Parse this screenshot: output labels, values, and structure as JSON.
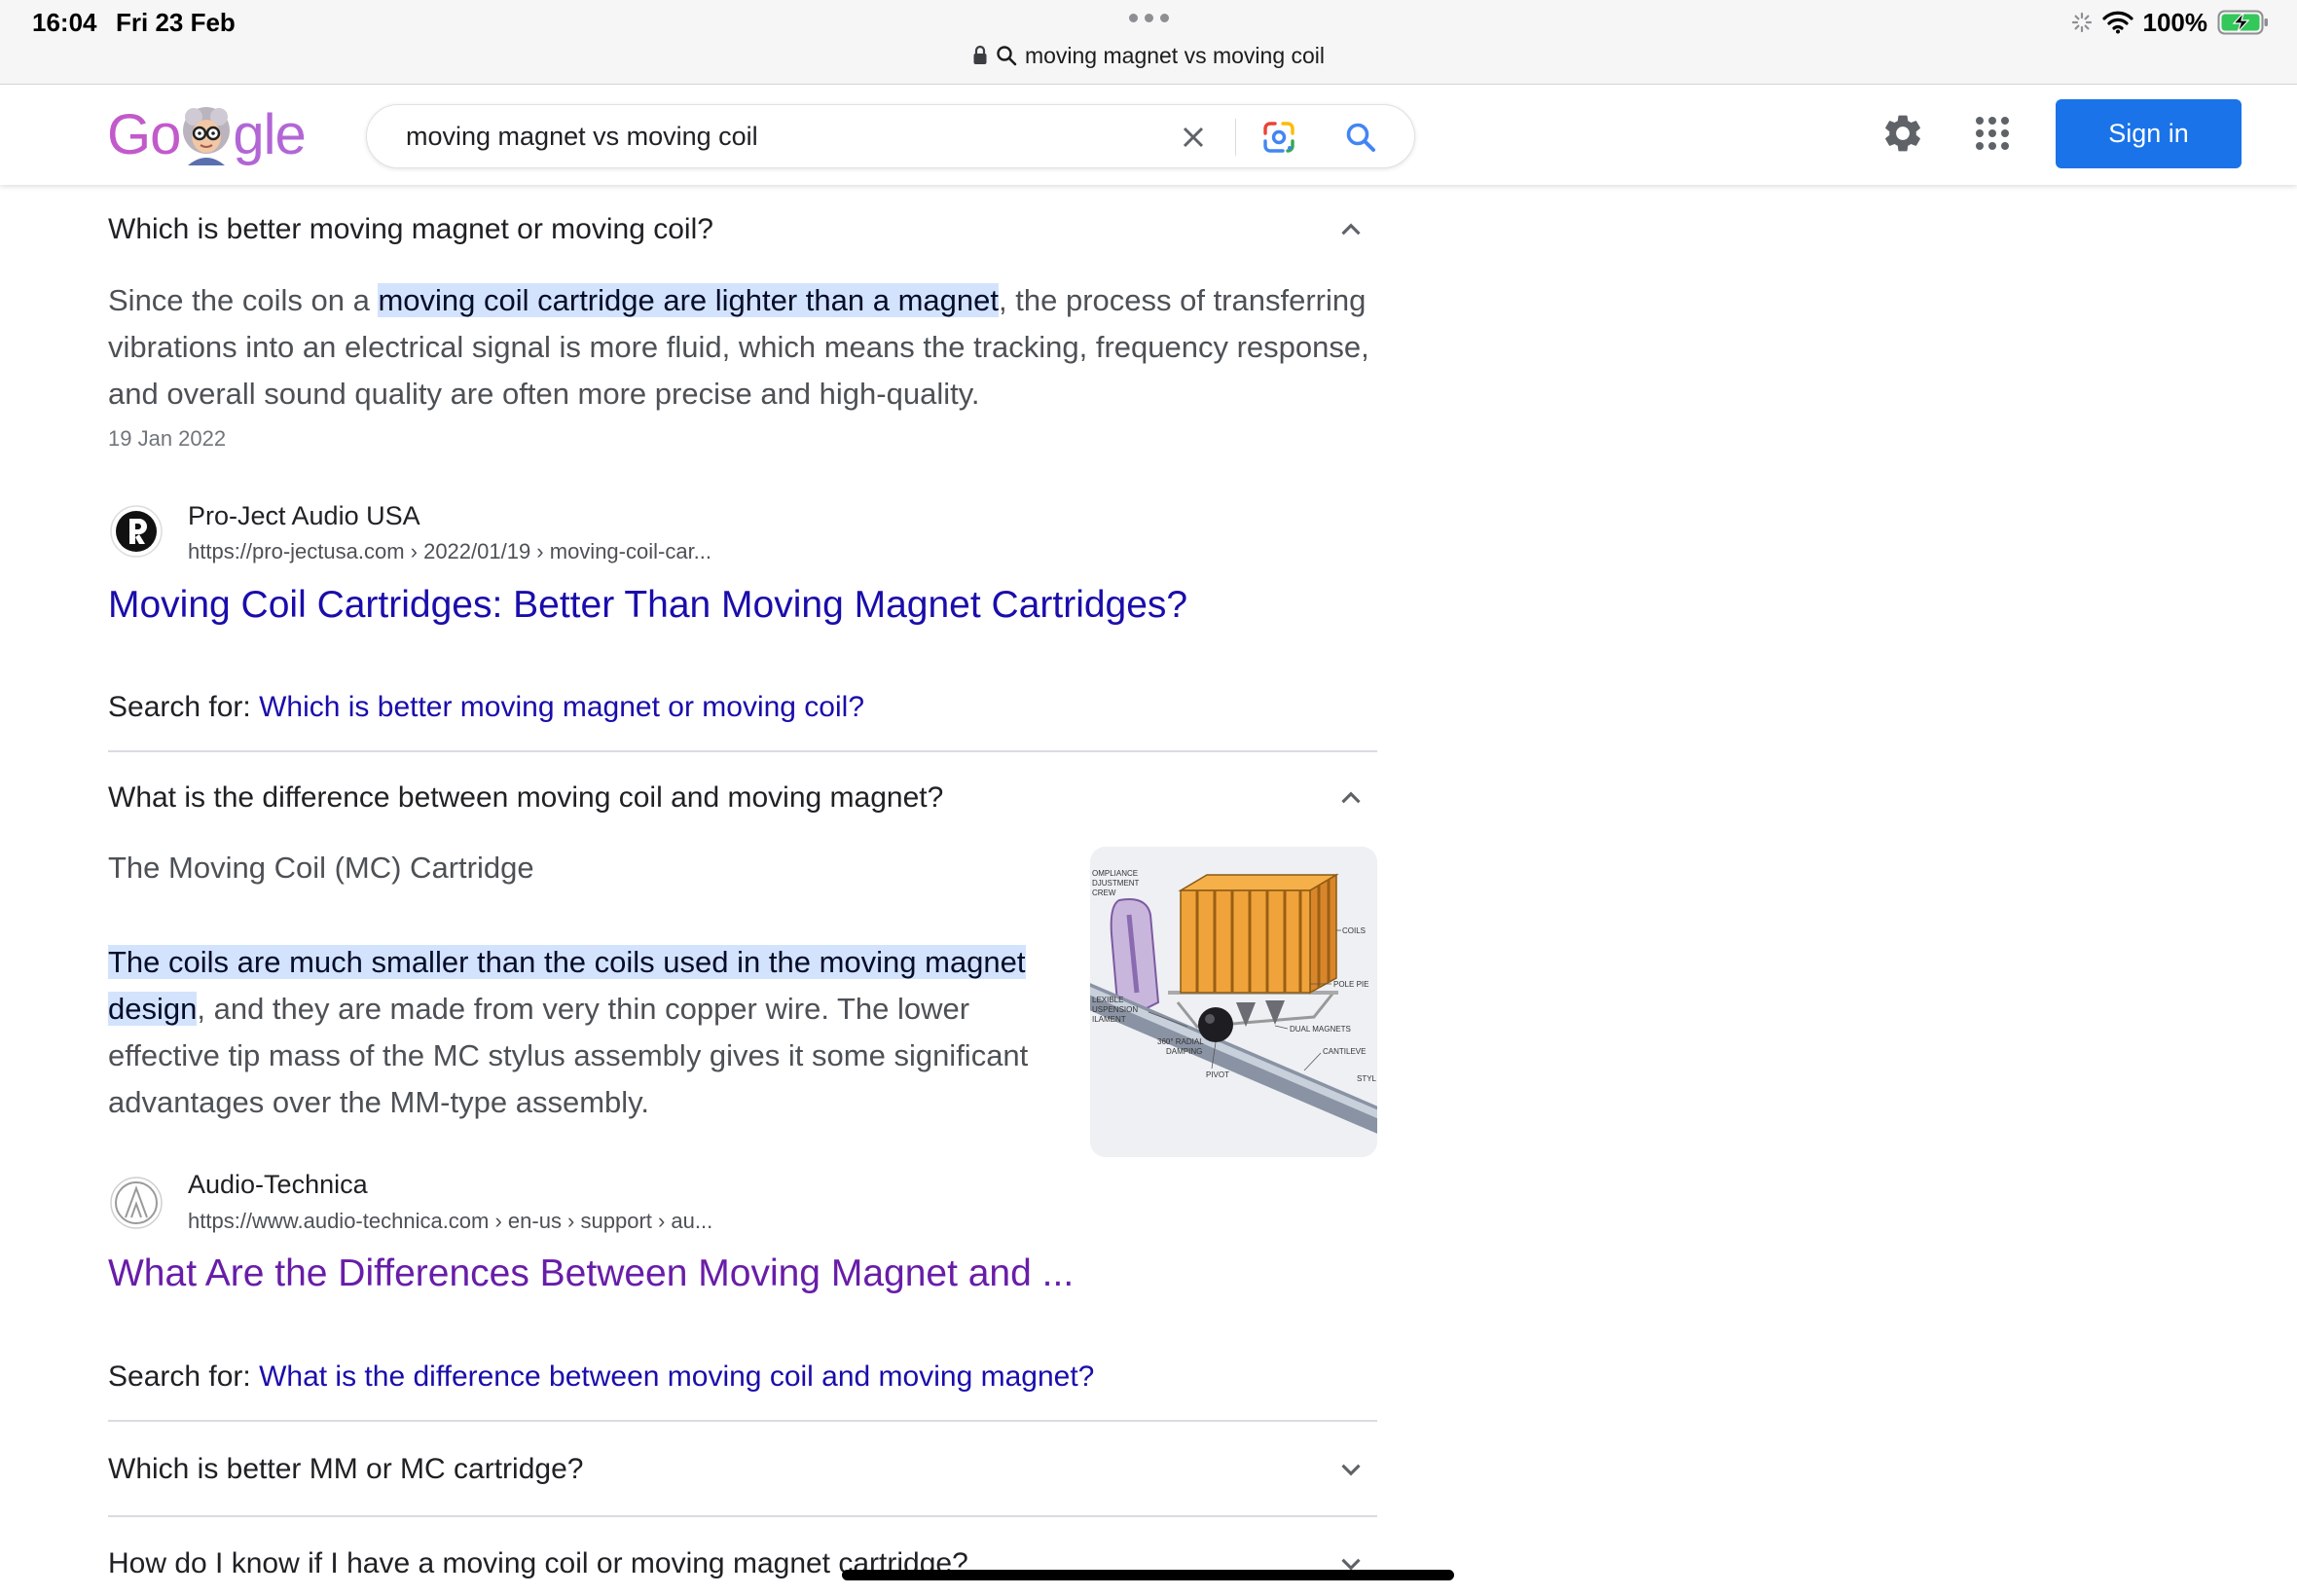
{
  "status_bar": {
    "time": "16:04",
    "date": "Fri 23 Feb",
    "battery": "100%"
  },
  "address_bar": {
    "url_text": "moving magnet vs moving coil"
  },
  "header": {
    "logo_left": "Go",
    "logo_right": "gle",
    "search_value": "moving magnet vs moving coil",
    "sign_in_label": "Sign in"
  },
  "faq": [
    {
      "question": "Which is better moving magnet or moving coil?",
      "expanded": true,
      "answer_before": "Since the coils on a ",
      "answer_highlight": "moving coil cartridge are lighter than a magnet",
      "answer_after": ", the process of transferring vibrations into an electrical signal is more fluid, which means the tracking, frequency response, and overall sound quality are often more precise and high-quality.",
      "date": "19 Jan 2022",
      "source_name": "Pro-Ject Audio USA",
      "source_url": "https://pro-jectusa.com › 2022/01/19 › moving-coil-car...",
      "result_title": "Moving Coil Cartridges: Better Than Moving Magnet Cartridges?",
      "search_for_label": "Search for: ",
      "search_for_query": "Which is better moving magnet or moving coil?"
    },
    {
      "question": "What is the difference between moving coil and moving magnet?",
      "expanded": true,
      "answer_heading": "The Moving Coil (MC) Cartridge",
      "answer_highlight": "The coils are much smaller than the coils used in the moving magnet design",
      "answer_after": ", and they are made from very thin copper wire. The lower effective tip mass of the MC stylus assembly gives it some significant advantages over the MM-type assembly.",
      "image_labels": [
        "OMPLIANCE",
        "DJUSTMENT",
        "CREW",
        "COILS",
        "POLE PIE",
        "LEXIBLE",
        "USPENSION",
        "ILAMENT",
        "360° RADIAL",
        "DAMPING",
        "DUAL MAGNETS",
        "CANTILEVE",
        "PIVOT",
        "STYL"
      ],
      "source_name": "Audio-Technica",
      "source_url": "https://www.audio-technica.com › en-us › support › au...",
      "result_title": "What Are the Differences Between Moving Magnet and ...",
      "result_visited": true,
      "search_for_label": "Search for: ",
      "search_for_query": "What is the difference between moving coil and moving magnet?"
    },
    {
      "question": "Which is better MM or MC cartridge?",
      "expanded": false
    },
    {
      "question": "How do I know if I have a moving coil or moving magnet cartridge?",
      "expanded": false
    }
  ],
  "colors": {
    "link": "#1a0dab",
    "visited_link": "#681da8",
    "sign_in_bg": "#1a73e8",
    "highlight": "#d3e3fd",
    "snippet_text": "#4d5156",
    "battery_green": "#34c759"
  },
  "icons": [
    "lock-icon",
    "search-icon",
    "wifi-icon",
    "battery-icon",
    "close-icon",
    "google-lens-icon",
    "gear-icon",
    "apps-grid-icon",
    "chevron-up-icon",
    "chevron-down-icon"
  ]
}
